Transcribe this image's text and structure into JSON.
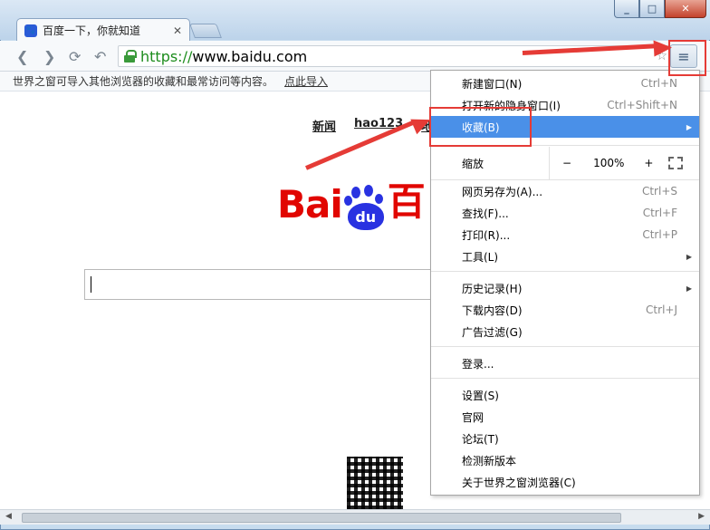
{
  "tab": {
    "title": "百度一下，你就知道",
    "favicon": "baidu-paw-icon"
  },
  "toolbar": {
    "url_scheme": "https://",
    "url_host": "www.baidu.com"
  },
  "importbar": {
    "text": "世界之窗可导入其他浏览器的收藏和最常访问等内容。",
    "link": "点此导入"
  },
  "page": {
    "links": [
      "新闻",
      "hao123",
      "地"
    ],
    "logo_left": "Bai",
    "logo_du": "du",
    "logo_right": "百"
  },
  "menu": {
    "items": [
      {
        "label": "新建窗口(N)",
        "shortcut": "Ctrl+N"
      },
      {
        "label": "打开新的隐身窗口(I)",
        "shortcut": "Ctrl+Shift+N"
      },
      {
        "label": "收藏(B)",
        "shortcut": ""
      },
      {
        "label": "网页另存为(A)...",
        "shortcut": "Ctrl+S"
      },
      {
        "label": "查找(F)...",
        "shortcut": "Ctrl+F"
      },
      {
        "label": "打印(R)...",
        "shortcut": "Ctrl+P"
      },
      {
        "label": "工具(L)",
        "shortcut": ""
      },
      {
        "label": "历史记录(H)",
        "shortcut": ""
      },
      {
        "label": "下载内容(D)",
        "shortcut": "Ctrl+J"
      },
      {
        "label": "广告过滤(G)",
        "shortcut": ""
      },
      {
        "label": "登录...",
        "shortcut": ""
      },
      {
        "label": "设置(S)",
        "shortcut": ""
      },
      {
        "label": "官网",
        "shortcut": ""
      },
      {
        "label": "论坛(T)",
        "shortcut": ""
      },
      {
        "label": "检测新版本",
        "shortcut": ""
      },
      {
        "label": "关于世界之窗浏览器(C)",
        "shortcut": ""
      }
    ],
    "zoom": {
      "label": "缩放",
      "minus": "−",
      "value": "100%",
      "plus": "+"
    }
  },
  "colors": {
    "highlight": "#4a90e8",
    "annotation": "#e53b36",
    "baidu_red": "#e10601",
    "baidu_blue": "#2932e1"
  }
}
